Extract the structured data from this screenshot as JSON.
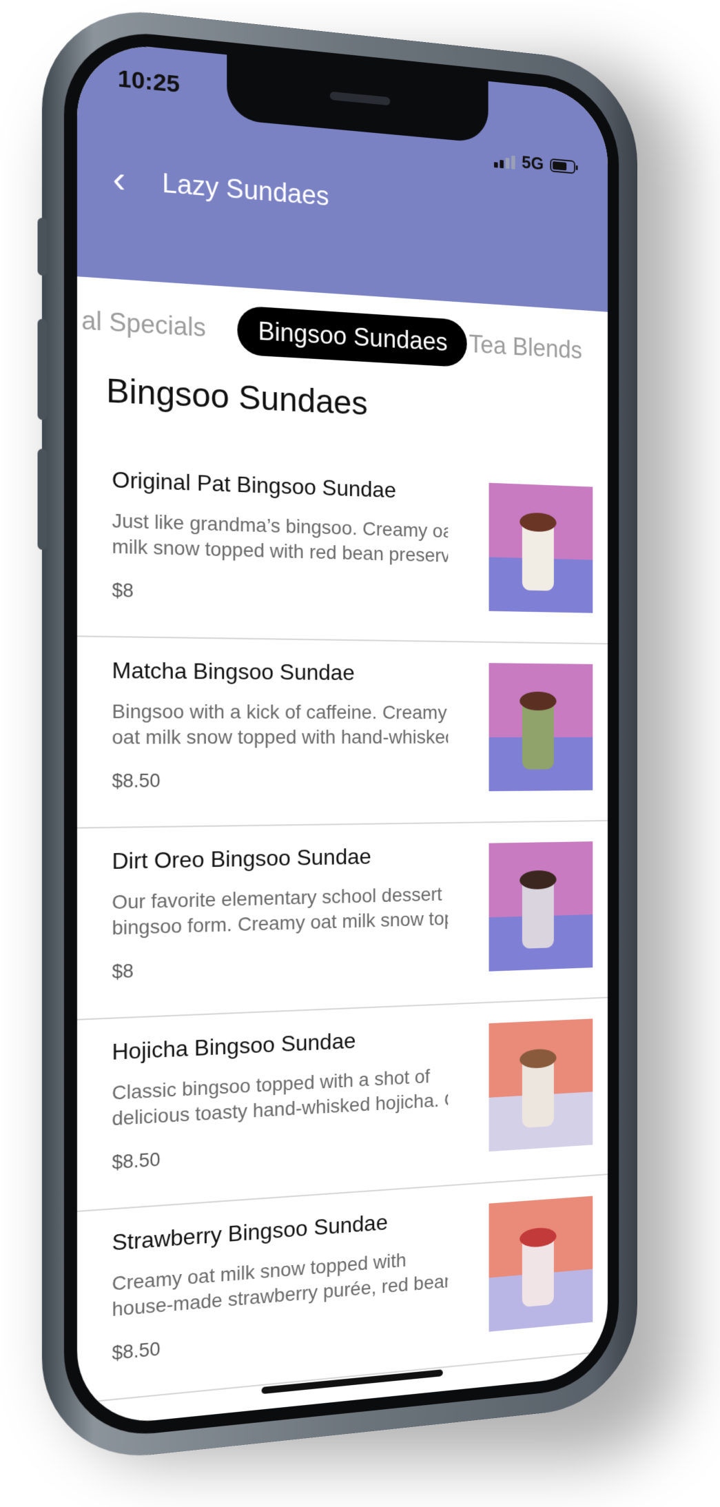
{
  "status_bar": {
    "time": "10:25",
    "network": "5G"
  },
  "header": {
    "title": "Lazy Sundaes"
  },
  "tabs": [
    {
      "label": "al Specials",
      "active": false
    },
    {
      "label": "Bingsoo Sundaes",
      "active": true
    },
    {
      "label": "Tea Blends",
      "active": false
    }
  ],
  "section": {
    "title": "Bingsoo Sundaes"
  },
  "items": [
    {
      "name": "Original Pat Bingsoo Sundae",
      "desc_line1": "Just like grandma’s bingsoo. Creamy oat",
      "desc_line2": "milk snow topped with red bean preserve,",
      "price": "$8",
      "image": {
        "wall": "#c97bc2",
        "floor": "#7f7fd6",
        "cup": "#f1ece4",
        "topping": "#6b3526"
      }
    },
    {
      "name": "Matcha Bingsoo Sundae",
      "desc_line1": "Bingsoo with a kick of caffeine. Creamy",
      "desc_line2": "oat milk snow topped with hand-whisked",
      "price": "$8.50",
      "image": {
        "wall": "#c97bc2",
        "floor": "#7f7fd6",
        "cup": "#8fa36a",
        "topping": "#5b2f22"
      }
    },
    {
      "name": "Dirt Oreo Bingsoo Sundae",
      "desc_line1": "Our favorite elementary school dessert in",
      "desc_line2": "bingsoo form. Creamy oat milk snow topp",
      "price": "$8",
      "image": {
        "wall": "#c97bc2",
        "floor": "#7f7fd6",
        "cup": "#d9d4de",
        "topping": "#3b2620"
      }
    },
    {
      "name": "Hojicha Bingsoo Sundae",
      "desc_line1": "Classic bingsoo topped with a shot of",
      "desc_line2": "delicious toasty hand-whisked hojicha. Cr",
      "price": "$8.50",
      "image": {
        "wall": "#ea8a78",
        "floor": "#d4d0e8",
        "cup": "#ece6df",
        "topping": "#8a5a3c"
      }
    },
    {
      "name": "Strawberry Bingsoo Sundae",
      "desc_line1": "Creamy oat milk snow topped with",
      "desc_line2": "house-made strawberry purée, red bean p",
      "price": "$8.50",
      "image": {
        "wall": "#ea8a78",
        "floor": "#b9b6e6",
        "cup": "#f0e4e6",
        "topping": "#c23a3a"
      }
    }
  ],
  "colors": {
    "header": "#7b82c4",
    "active_tab_bg": "#000000",
    "phone_frame": "#6d757c"
  }
}
